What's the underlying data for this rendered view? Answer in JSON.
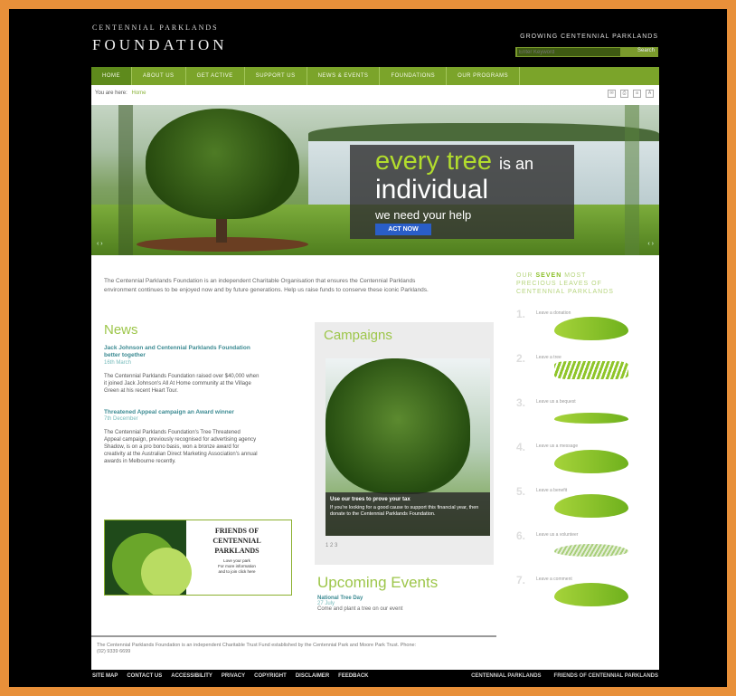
{
  "header": {
    "logo_small": "CENTENNIAL PARKLANDS",
    "logo_big": "FOUNDATION",
    "tagline": "GROWING CENTENNIAL PARKLANDS",
    "search_placeholder": "Enter Keyword",
    "search_button": "Search"
  },
  "nav": [
    "HOME",
    "ABOUT US",
    "GET ACTIVE",
    "SUPPORT US",
    "NEWS & EVENTS",
    "FOUNDATIONS",
    "OUR PROGRAMS"
  ],
  "breadcrumb": {
    "label": "You are here:",
    "current": "Home"
  },
  "hero": {
    "line1": "every tree",
    "line1b": "is an",
    "line2": "individual",
    "line3": "we need your help",
    "cta": "ACT NOW"
  },
  "intro": "The Centennial Parklands Foundation is an independent Charitable Organisation that ensures the Centennial Parklands environment continues to be enjoyed now and by future generations. Help us raise funds to conserve these iconic Parklands.",
  "sidebar": {
    "title_pre": "OUR",
    "title_bold": "SEVEN",
    "title_post": "MOST",
    "title_line2": "PRECIOUS LEAVES OF",
    "title_line3": "CENTENNIAL PARKLANDS",
    "leaves": [
      {
        "num": "1.",
        "label": "Leave a donation"
      },
      {
        "num": "2.",
        "label": "Leave a tree"
      },
      {
        "num": "3.",
        "label": "Leave us a bequest"
      },
      {
        "num": "4.",
        "label": "Leave us a message"
      },
      {
        "num": "5.",
        "label": "Leave a benefit"
      },
      {
        "num": "6.",
        "label": "Leave us a volunteer"
      },
      {
        "num": "7.",
        "label": "Leave a comment"
      }
    ]
  },
  "news": {
    "title": "News",
    "a1_title": "Jack Johnson and Centennial Parklands Foundation better together",
    "a1_date": "16th March",
    "a1_text": "The Centennial Parklands Foundation raised over $40,000 when it joined Jack Johnson's All At Home community at the Village Green at his recent Heart Tour.",
    "a2_title": "Threatened Appeal campaign an Award winner",
    "a2_date": "7th December",
    "a2_text": "The Centennial Parklands Foundation's Tree Threatened Appeal campaign, previously recognised for advertising agency Shadow, is on a pro bono basis, won a bronze award for creativity at the Australian Direct Marketing Association's annual awards in Melbourne recently."
  },
  "friends": {
    "line1": "FRIENDS OF",
    "line2": "CENTENNIAL",
    "line3": "PARKLANDS",
    "line4": "Love your park",
    "line5": "For more information",
    "line6": "and to join click here"
  },
  "campaigns": {
    "title": "Campaigns",
    "cap_title": "Use our trees to prove your tax",
    "cap_body": "If you're looking for a good cause to support this financial year, then donate to the Centennial Parklands Foundation.",
    "pager": "1  2  3"
  },
  "events": {
    "title": "Upcoming Events",
    "e1": "National Tree Day",
    "e2": "27 July",
    "e3": "Come and plant a tree on our event"
  },
  "footer": {
    "text": "The Centennial Parklands Foundation is an independent Charitable Trust Fund established by the Centennial Park and Moore Park Trust. Phone: (02) 9339 6699"
  },
  "bottom_links": [
    "SITE MAP",
    "CONTACT US",
    "ACCESSIBILITY",
    "PRIVACY",
    "COPYRIGHT",
    "DISCLAIMER",
    "FEEDBACK"
  ],
  "bottom_right": [
    "CENTENNIAL PARKLANDS",
    "FRIENDS OF CENTENNIAL PARKLANDS"
  ]
}
